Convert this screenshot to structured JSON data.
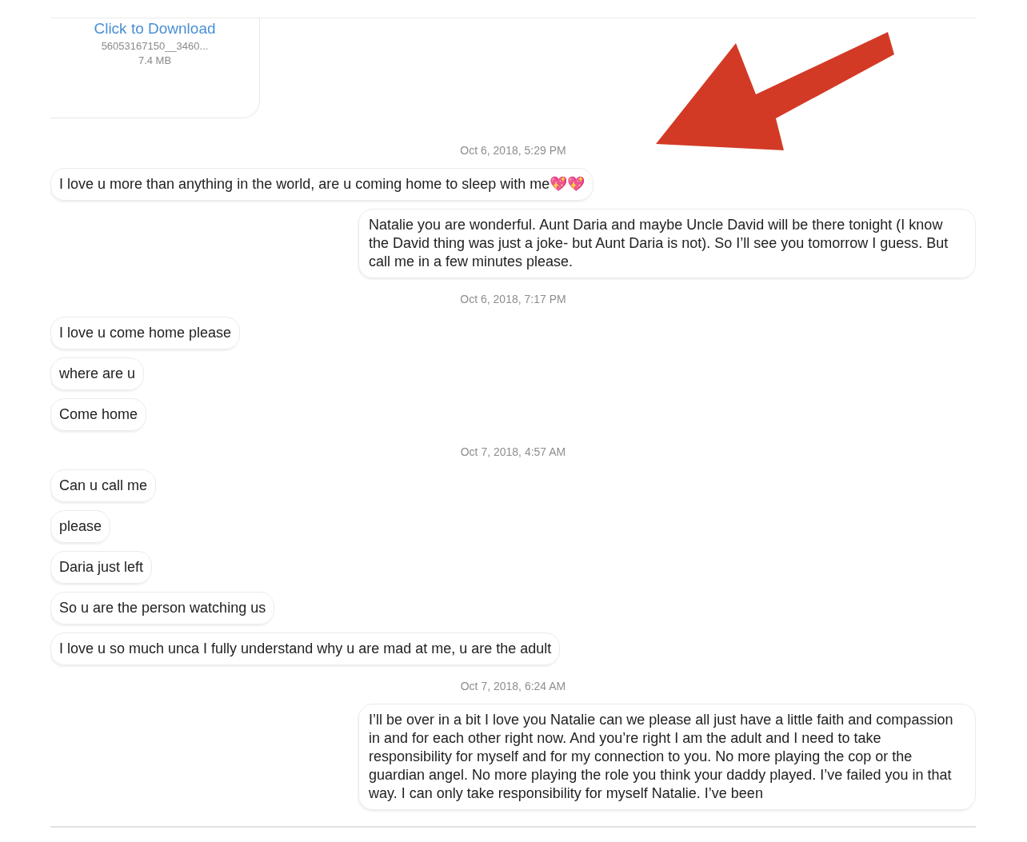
{
  "messages": [
    {
      "kind": "file",
      "link": "Click to Download",
      "filename": "56053167150__3460...",
      "size": "7.4 MB"
    },
    {
      "kind": "timestamp",
      "text": "Oct 6, 2018, 5:29 PM"
    },
    {
      "kind": "incoming",
      "text": "I love u more than anything in the world, are u coming home to sleep with me💖💖"
    },
    {
      "kind": "outgoing",
      "text": "Natalie you are wonderful. Aunt Daria and maybe Uncle David will be there tonight (I know the David thing was just a joke- but Aunt Daria is not). So I’ll see you tomorrow I guess. But call me in a few minutes please."
    },
    {
      "kind": "timestamp",
      "text": "Oct 6, 2018, 7:17 PM"
    },
    {
      "kind": "incoming",
      "text": "I love u come home please"
    },
    {
      "kind": "incoming",
      "text": "where are u"
    },
    {
      "kind": "incoming",
      "text": "Come home"
    },
    {
      "kind": "timestamp",
      "text": "Oct 7, 2018, 4:57 AM"
    },
    {
      "kind": "incoming",
      "text": "Can u call me"
    },
    {
      "kind": "incoming",
      "text": "please"
    },
    {
      "kind": "incoming",
      "text": "Daria just left"
    },
    {
      "kind": "incoming",
      "text": "So u are the person watching us"
    },
    {
      "kind": "incoming",
      "text": "I love u so much unca I fully understand why u are mad at me, u are the adult"
    },
    {
      "kind": "timestamp",
      "text": "Oct 7, 2018, 6:24 AM"
    },
    {
      "kind": "outgoing",
      "text": "I’ll be over in a bit I love you Natalie can we please all just have a little faith and compassion in and for each other right now. And you’re right I am the adult and I need to take responsibility for myself and for my connection to you. No more playing the cop or the guardian angel. No more playing the role you think your daddy played. I’ve failed you in that way. I can only take responsibility for myself Natalie. I’ve been"
    }
  ]
}
